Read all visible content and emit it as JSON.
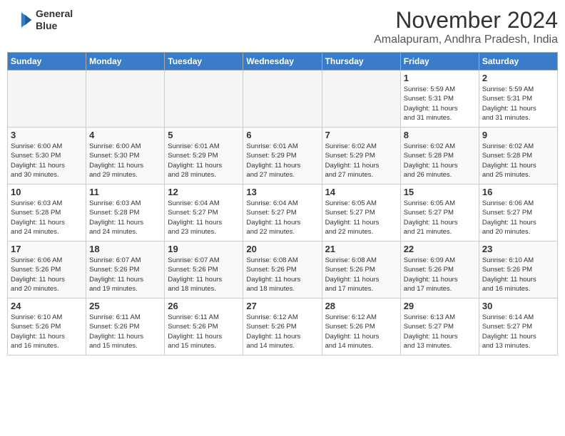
{
  "header": {
    "logo_line1": "General",
    "logo_line2": "Blue",
    "month": "November 2024",
    "location": "Amalapuram, Andhra Pradesh, India"
  },
  "weekdays": [
    "Sunday",
    "Monday",
    "Tuesday",
    "Wednesday",
    "Thursday",
    "Friday",
    "Saturday"
  ],
  "weeks": [
    [
      {
        "day": "",
        "info": ""
      },
      {
        "day": "",
        "info": ""
      },
      {
        "day": "",
        "info": ""
      },
      {
        "day": "",
        "info": ""
      },
      {
        "day": "",
        "info": ""
      },
      {
        "day": "1",
        "info": "Sunrise: 5:59 AM\nSunset: 5:31 PM\nDaylight: 11 hours\nand 31 minutes."
      },
      {
        "day": "2",
        "info": "Sunrise: 5:59 AM\nSunset: 5:31 PM\nDaylight: 11 hours\nand 31 minutes."
      }
    ],
    [
      {
        "day": "3",
        "info": "Sunrise: 6:00 AM\nSunset: 5:30 PM\nDaylight: 11 hours\nand 30 minutes."
      },
      {
        "day": "4",
        "info": "Sunrise: 6:00 AM\nSunset: 5:30 PM\nDaylight: 11 hours\nand 29 minutes."
      },
      {
        "day": "5",
        "info": "Sunrise: 6:01 AM\nSunset: 5:29 PM\nDaylight: 11 hours\nand 28 minutes."
      },
      {
        "day": "6",
        "info": "Sunrise: 6:01 AM\nSunset: 5:29 PM\nDaylight: 11 hours\nand 27 minutes."
      },
      {
        "day": "7",
        "info": "Sunrise: 6:02 AM\nSunset: 5:29 PM\nDaylight: 11 hours\nand 27 minutes."
      },
      {
        "day": "8",
        "info": "Sunrise: 6:02 AM\nSunset: 5:28 PM\nDaylight: 11 hours\nand 26 minutes."
      },
      {
        "day": "9",
        "info": "Sunrise: 6:02 AM\nSunset: 5:28 PM\nDaylight: 11 hours\nand 25 minutes."
      }
    ],
    [
      {
        "day": "10",
        "info": "Sunrise: 6:03 AM\nSunset: 5:28 PM\nDaylight: 11 hours\nand 24 minutes."
      },
      {
        "day": "11",
        "info": "Sunrise: 6:03 AM\nSunset: 5:28 PM\nDaylight: 11 hours\nand 24 minutes."
      },
      {
        "day": "12",
        "info": "Sunrise: 6:04 AM\nSunset: 5:27 PM\nDaylight: 11 hours\nand 23 minutes."
      },
      {
        "day": "13",
        "info": "Sunrise: 6:04 AM\nSunset: 5:27 PM\nDaylight: 11 hours\nand 22 minutes."
      },
      {
        "day": "14",
        "info": "Sunrise: 6:05 AM\nSunset: 5:27 PM\nDaylight: 11 hours\nand 22 minutes."
      },
      {
        "day": "15",
        "info": "Sunrise: 6:05 AM\nSunset: 5:27 PM\nDaylight: 11 hours\nand 21 minutes."
      },
      {
        "day": "16",
        "info": "Sunrise: 6:06 AM\nSunset: 5:27 PM\nDaylight: 11 hours\nand 20 minutes."
      }
    ],
    [
      {
        "day": "17",
        "info": "Sunrise: 6:06 AM\nSunset: 5:26 PM\nDaylight: 11 hours\nand 20 minutes."
      },
      {
        "day": "18",
        "info": "Sunrise: 6:07 AM\nSunset: 5:26 PM\nDaylight: 11 hours\nand 19 minutes."
      },
      {
        "day": "19",
        "info": "Sunrise: 6:07 AM\nSunset: 5:26 PM\nDaylight: 11 hours\nand 18 minutes."
      },
      {
        "day": "20",
        "info": "Sunrise: 6:08 AM\nSunset: 5:26 PM\nDaylight: 11 hours\nand 18 minutes."
      },
      {
        "day": "21",
        "info": "Sunrise: 6:08 AM\nSunset: 5:26 PM\nDaylight: 11 hours\nand 17 minutes."
      },
      {
        "day": "22",
        "info": "Sunrise: 6:09 AM\nSunset: 5:26 PM\nDaylight: 11 hours\nand 17 minutes."
      },
      {
        "day": "23",
        "info": "Sunrise: 6:10 AM\nSunset: 5:26 PM\nDaylight: 11 hours\nand 16 minutes."
      }
    ],
    [
      {
        "day": "24",
        "info": "Sunrise: 6:10 AM\nSunset: 5:26 PM\nDaylight: 11 hours\nand 16 minutes."
      },
      {
        "day": "25",
        "info": "Sunrise: 6:11 AM\nSunset: 5:26 PM\nDaylight: 11 hours\nand 15 minutes."
      },
      {
        "day": "26",
        "info": "Sunrise: 6:11 AM\nSunset: 5:26 PM\nDaylight: 11 hours\nand 15 minutes."
      },
      {
        "day": "27",
        "info": "Sunrise: 6:12 AM\nSunset: 5:26 PM\nDaylight: 11 hours\nand 14 minutes."
      },
      {
        "day": "28",
        "info": "Sunrise: 6:12 AM\nSunset: 5:26 PM\nDaylight: 11 hours\nand 14 minutes."
      },
      {
        "day": "29",
        "info": "Sunrise: 6:13 AM\nSunset: 5:27 PM\nDaylight: 11 hours\nand 13 minutes."
      },
      {
        "day": "30",
        "info": "Sunrise: 6:14 AM\nSunset: 5:27 PM\nDaylight: 11 hours\nand 13 minutes."
      }
    ]
  ]
}
